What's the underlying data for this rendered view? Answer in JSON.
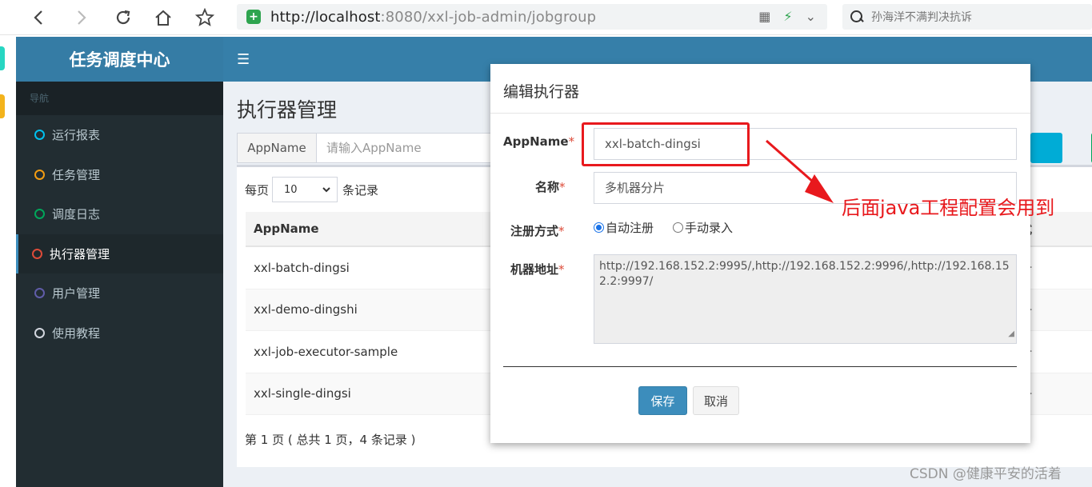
{
  "browser": {
    "url_host": "http://localhost",
    "url_rest": ":8080/xxl-job-admin/jobgroup",
    "search_placeholder": "孙海洋不满判决抗诉"
  },
  "app": {
    "logo": "任务调度中心",
    "nav_header": "导航",
    "menu": [
      {
        "label": "运行报表",
        "color": "#00c0ef"
      },
      {
        "label": "任务管理",
        "color": "#f39c12"
      },
      {
        "label": "调度日志",
        "color": "#00a65a"
      },
      {
        "label": "执行器管理",
        "color": "#dd4b39"
      },
      {
        "label": "用户管理",
        "color": "#605ca8"
      },
      {
        "label": "使用教程",
        "color": "#d2d6de"
      }
    ]
  },
  "page": {
    "title": "执行器管理",
    "search_label": "AppName",
    "search_placeholder": "请输入AppName",
    "length_prefix": "每页",
    "length_value": "10",
    "length_suffix": "条记录",
    "table_header_appname": "AppName",
    "table_header_type_partial": "式",
    "rows": [
      {
        "appname": "xxl-batch-dingsi",
        "type_partial": "册"
      },
      {
        "appname": "xxl-demo-dingshi",
        "type_partial": "册"
      },
      {
        "appname": "xxl-job-executor-sample",
        "type_partial": "册"
      },
      {
        "appname": "xxl-single-dingsi",
        "type_partial": "册"
      }
    ],
    "pager": "第 1 页 ( 总共 1 页，4 条记录 )"
  },
  "modal": {
    "title": "编辑执行器",
    "appname_label": "AppName",
    "appname_value": "xxl-batch-dingsi",
    "name_label": "名称",
    "name_value": "多机器分片",
    "reg_label": "注册方式",
    "reg_auto": "自动注册",
    "reg_manual": "手动录入",
    "addr_label": "机器地址",
    "addr_value": "http://192.168.152.2:9995/,http://192.168.152.2:9996/,http://192.168.152.2:9997/",
    "save": "保存",
    "cancel": "取消",
    "required_mark": "*"
  },
  "annotation": {
    "text": "后面java工程配置会用到"
  },
  "watermark": "CSDN @健康平安的活着"
}
